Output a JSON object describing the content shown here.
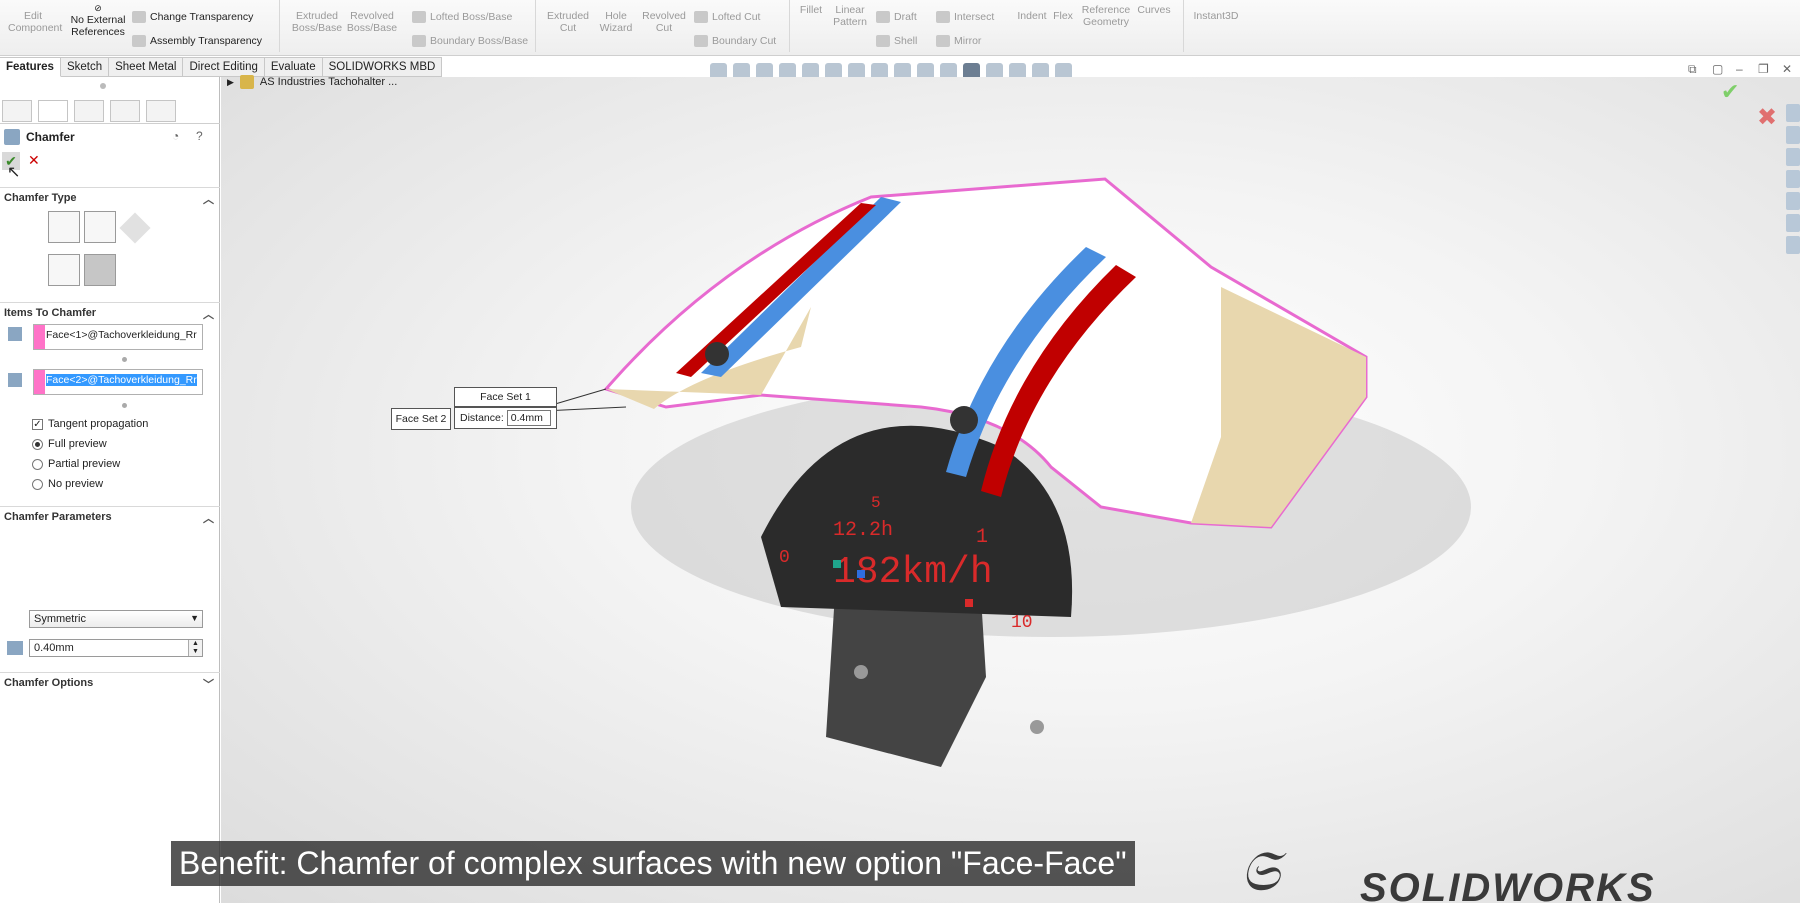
{
  "ribbon": {
    "edit_component": "Edit Component",
    "no_external_references": "No External References",
    "change_transparency": "Change Transparency",
    "assembly_transparency": "Assembly Transparency",
    "extruded_boss": "Extruded Boss/Base",
    "revolved_boss": "Revolved Boss/Base",
    "lofted_boss": "Lofted Boss/Base",
    "boundary_boss": "Boundary Boss/Base",
    "extruded_cut": "Extruded Cut",
    "hole_wizard": "Hole Wizard",
    "revolved_cut": "Revolved Cut",
    "lofted_cut": "Lofted Cut",
    "boundary_cut": "Boundary Cut",
    "fillet": "Fillet",
    "linear_pattern": "Linear Pattern",
    "draft": "Draft",
    "intersect": "Intersect",
    "shell": "Shell",
    "mirror": "Mirror",
    "indent": "Indent",
    "flex": "Flex",
    "reference_geometry": "Reference Geometry",
    "curves": "Curves",
    "instant3d": "Instant3D"
  },
  "tabs": [
    "Features",
    "Sketch",
    "Sheet Metal",
    "Direct Editing",
    "Evaluate",
    "SOLIDWORKS MBD"
  ],
  "tree": {
    "root": "AS Industries Tachohalter ..."
  },
  "panel": {
    "title": "Chamfer",
    "chamfer_type_header": "Chamfer Type",
    "items_header": "Items To Chamfer",
    "face1": "Face<1>@Tachoverkleidung_Rr",
    "face2": "Face<2>@Tachoverkleidung_Rr",
    "tangent": "Tangent propagation",
    "full_preview": "Full preview",
    "partial_preview": "Partial preview",
    "no_preview": "No preview",
    "params_header": "Chamfer Parameters",
    "symmetric": "Symmetric",
    "distance": "0.40mm",
    "options_header": "Chamfer Options"
  },
  "callouts": {
    "face_set_1": "Face Set 1",
    "face_set_2": "Face Set 2",
    "distance_label": "Distance:",
    "distance_value": "0.4mm"
  },
  "dashboard": {
    "gear": "5",
    "value1": "12.2h",
    "value2": "1",
    "speed": "182km/h",
    "left": "0",
    "right": "10"
  },
  "subtitle": "Benefit: Chamfer of complex surfaces with new option \"Face-Face\"",
  "brand": "SOLIDWORKS",
  "colors": {
    "accent": "#ff73c8",
    "selection": "#3399ff",
    "stripe_blue": "#4a8fe0",
    "stripe_red": "#c00000"
  }
}
